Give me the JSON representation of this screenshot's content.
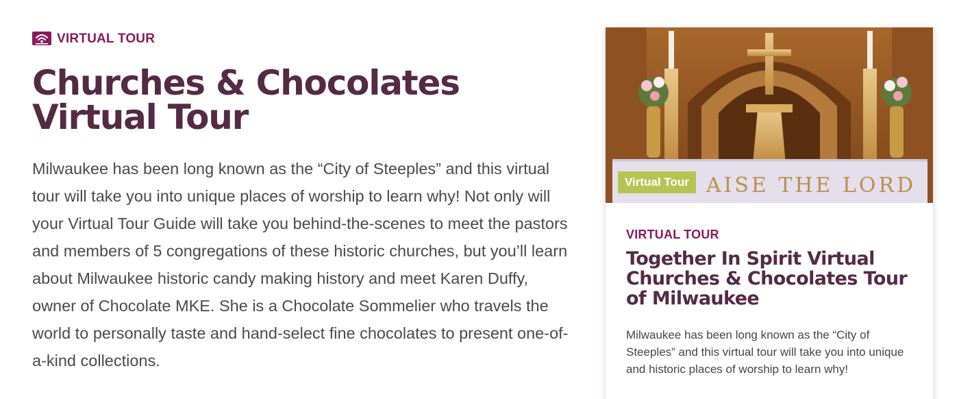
{
  "main": {
    "eyebrow": {
      "icon": "virtual-tour-icon",
      "label": "VIRTUAL TOUR"
    },
    "title": "Churches & Chocolates Virtual Tour",
    "description": "Milwaukee has been long known as the “City of Steeples” and this virtual tour will take you into unique places of worship to learn why! Not only will your Virtual Tour Guide will take you behind-the-scenes to meet the pastors and members of 5 congregations of these historic churches, but you’ll learn about Milwaukee historic candy making history and meet Karen Duffy, owner of Chocolate MKE. She is a Chocolate Sommelier who travels the world to personally taste and hand-select fine chocolates to present one-of-a-kind collections."
  },
  "card": {
    "image_badge": "Virtual Tour",
    "image_caption": "AISE THE LORD",
    "eyebrow": "VIRTUAL TOUR",
    "title": "Together In Spirit Virtual Churches & Chocolates Tour of Milwaukee",
    "description": "Milwaukee has been long known as the “City of Steeples” and this virtual tour will take you into unique and historic places of worship to learn why!"
  },
  "colors": {
    "accent": "#8a1a5c",
    "heading": "#552a45",
    "body_text": "#4a4a4a",
    "badge": "#b6c456"
  }
}
